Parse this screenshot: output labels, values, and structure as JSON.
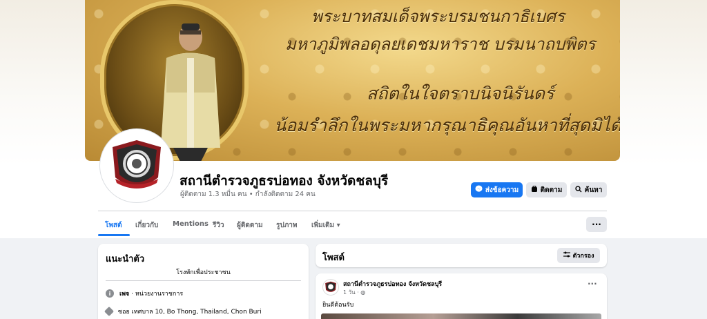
{
  "cover": {
    "lines": [
      "พระบาทสมเด็จพระบรมชนกาธิเบศร",
      "มหาภูมิพลอดุลยเดชมหาราช บรมนาถบพิตร",
      "สถิตในใจตราบนิจนิรันดร์",
      "น้อมรำลึกในพระมหากรุณาธิคุณอันหาที่สุดมิได้"
    ]
  },
  "page": {
    "name": "สถานีตำรวจภูธรบ่อทอง จังหวัดชลบุรี",
    "stats": "ผู้ติดตาม 1.3 หมื่น คน • กำลังติดตาม 24 คน"
  },
  "actions": {
    "message": "ส่งข้อความ",
    "follow": "ติดตาม",
    "search": "ค้นหา"
  },
  "tabs": [
    {
      "label": "โพสต์"
    },
    {
      "label": "เกี่ยวกับ"
    },
    {
      "label": "Mentions"
    },
    {
      "label": "รีวิว"
    },
    {
      "label": "ผู้ติดตาม"
    },
    {
      "label": "รูปภาพ"
    },
    {
      "label": "เพิ่มเติม ▾"
    }
  ],
  "more_button": "···",
  "intro": {
    "title": "แนะนำตัว",
    "bio": "โรงพักเพื่อประชาชน",
    "rows": [
      {
        "icon": "info-icon",
        "bold": "เพจ",
        "text": " · หน่วยงานราชการ"
      },
      {
        "icon": "location-icon",
        "bold": "",
        "text": "ซอย เทศบาล 10, Bo Thong, Thailand, Chon Buri"
      }
    ]
  },
  "posts": {
    "title": "โพสต์",
    "filter": "ตัวกรอง"
  },
  "post": {
    "author": "สถานีตำรวจภูธรบ่อทอง จังหวัดชลบุรี",
    "time": "1 วัน · ",
    "text": "ยินดีต้อนรับ",
    "menu": "···"
  },
  "colors": {
    "accent": "#1877f2",
    "background": "#f0f2f5",
    "button_gray": "#e4e6eb"
  }
}
